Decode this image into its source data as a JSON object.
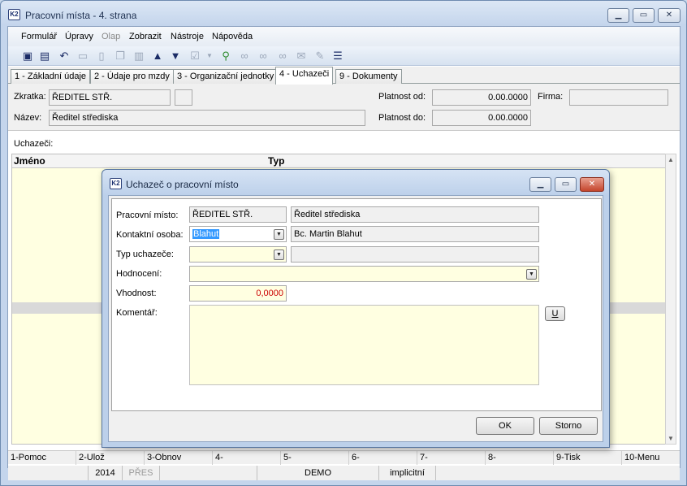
{
  "window": {
    "title": "Pracovní místa - 4. strana",
    "icon": "K2",
    "minimize": "▁",
    "maximize": "▭",
    "close": "✕"
  },
  "menu": [
    "Formulář",
    "Úpravy",
    "Olap",
    "Zobrazit",
    "Nástroje",
    "Nápověda"
  ],
  "toolbar": {
    "icons": [
      "save-icon",
      "save-as-icon",
      "undo-icon",
      "open-folder-icon",
      "new-document-icon",
      "copy-icon",
      "book-icon",
      "arrow-up-icon",
      "arrow-down-icon",
      "check-icon",
      "dropdown-icon",
      "filter-icon",
      "binoculars-icon",
      "binoculars-next-icon",
      "binoculars-prev-icon",
      "mail-icon",
      "edit-icon",
      "menu-icon"
    ]
  },
  "tabs": [
    {
      "label": "1 - Základní údaje"
    },
    {
      "label": "2 - Údaje pro mzdy"
    },
    {
      "label": "3 - Organizační jednotky"
    },
    {
      "label": "4 - Uchazeči"
    },
    {
      "label": "9 - Dokumenty"
    }
  ],
  "header": {
    "zkratka_label": "Zkratka:",
    "zkratka_value": "ŘEDITEL STŘ.",
    "nazev_label": "Název:",
    "nazev_value": "Ředitel střediska",
    "platnost_od_label": "Platnost od:",
    "platnost_od_value": "0.00.0000",
    "platnost_do_label": "Platnost do:",
    "platnost_do_value": "0.00.0000",
    "firma_label": "Firma:",
    "firma_value": ""
  },
  "list": {
    "label": "Uchazeči:",
    "columns": [
      "Jméno",
      "Typ"
    ]
  },
  "fkeys": [
    "1-Pomoc",
    "2-Ulož",
    "3-Obnov",
    "4-",
    "5-",
    "6-",
    "7-",
    "8-",
    "9-Tisk",
    "10-Menu"
  ],
  "status": {
    "year": "2014",
    "mode": "PŘES",
    "db": "DEMO",
    "profile": "implicitní"
  },
  "dialog": {
    "title": "Uchazeč o pracovní místo",
    "pracovni_misto_label": "Pracovní místo:",
    "pracovni_misto_code": "ŘEDITEL STŘ.",
    "pracovni_misto_name": "Ředitel střediska",
    "kontaktni_osoba_label": "Kontaktní osoba:",
    "kontaktni_osoba_value": "Blahut",
    "kontaktni_osoba_name": "Bc. Martin Blahut",
    "typ_uchazece_label": "Typ uchazeče:",
    "typ_uchazece_value": "",
    "typ_uchazece_name": "",
    "hodnoceni_label": "Hodnocení:",
    "hodnoceni_value": "",
    "vhodnost_label": "Vhodnost:",
    "vhodnost_value": "0,0000",
    "komentar_label": "Komentář:",
    "komentar_value": "",
    "u_button": "U",
    "ok_button": "OK",
    "storno_button": "Storno",
    "vhodnost_color": "#cc0000"
  }
}
